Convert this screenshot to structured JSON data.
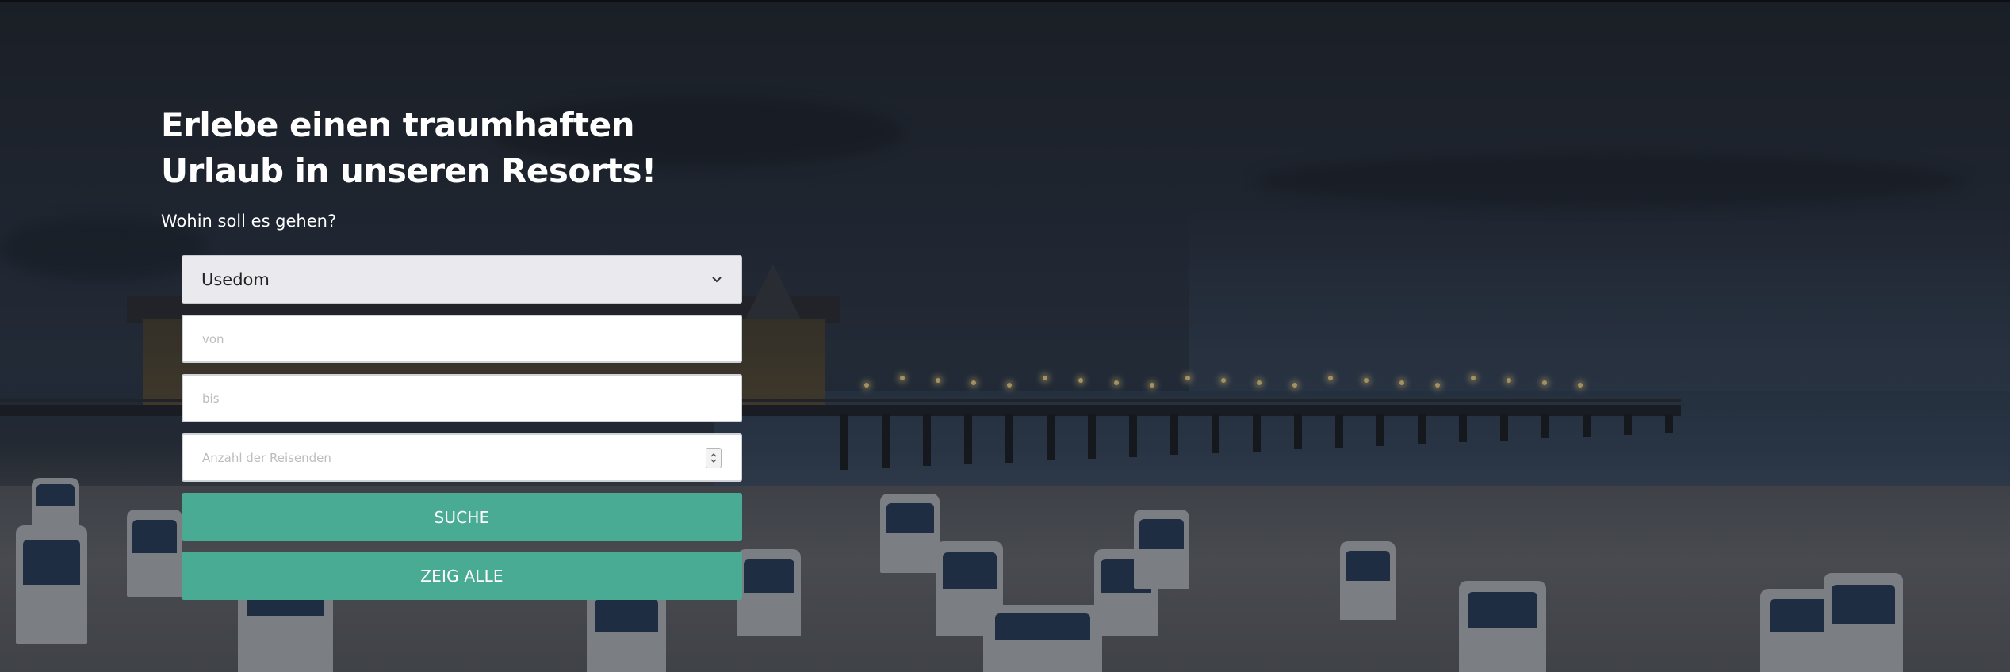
{
  "hero": {
    "headline": "Erlebe einen traumhaften Urlaub in unseren Resorts!",
    "subheadline": "Wohin soll es gehen?",
    "background_image": "beach-pier-at-dusk"
  },
  "search_form": {
    "destination_select": {
      "value": "Usedom",
      "icon": "chevron-down-icon"
    },
    "from_input": {
      "value": "",
      "placeholder": "von"
    },
    "to_input": {
      "value": "",
      "placeholder": "bis"
    },
    "travelers_input": {
      "value": "",
      "placeholder": "Anzahl der Reisenden",
      "icon": "number-spinner-icon"
    },
    "search_button": "SUCHE",
    "show_all_button": "ZEIG ALLE"
  },
  "colors": {
    "button_accent": "#4aab94",
    "select_background": "#e9e9ee",
    "text_light": "#ffffff"
  }
}
